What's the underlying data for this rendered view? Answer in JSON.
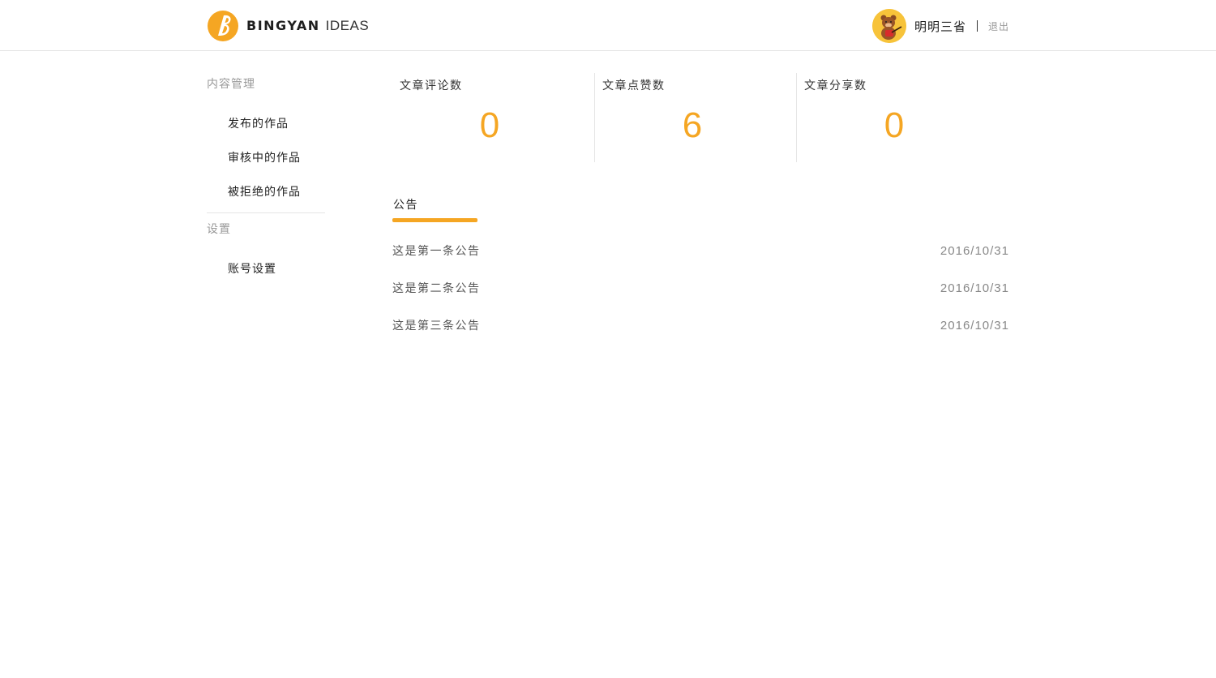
{
  "header": {
    "brand": "BINGYAN",
    "brand_sub": "IDEAS",
    "user_name": "明明三省",
    "logout_label": "退出"
  },
  "sidebar": {
    "groups": [
      {
        "title": "内容管理",
        "items": [
          "发布的作品",
          "审核中的作品",
          "被拒绝的作品"
        ]
      },
      {
        "title": "设置",
        "items": [
          "账号设置"
        ]
      }
    ]
  },
  "stats": [
    {
      "label": "文章评论数",
      "value": "0"
    },
    {
      "label": "文章点赞数",
      "value": "6"
    },
    {
      "label": "文章分享数",
      "value": "0"
    }
  ],
  "notice": {
    "tab_label": "公告",
    "items": [
      {
        "title": "这是第一条公告",
        "date": "2016/10/31"
      },
      {
        "title": "这是第二条公告",
        "date": "2016/10/31"
      },
      {
        "title": "这是第三条公告",
        "date": "2016/10/31"
      }
    ]
  },
  "colors": {
    "accent": "#f5a623",
    "avatar_bg": "#f7c33a"
  },
  "icons": {
    "logo": "bingyan-logo-icon",
    "avatar": "bear-avatar-icon"
  }
}
